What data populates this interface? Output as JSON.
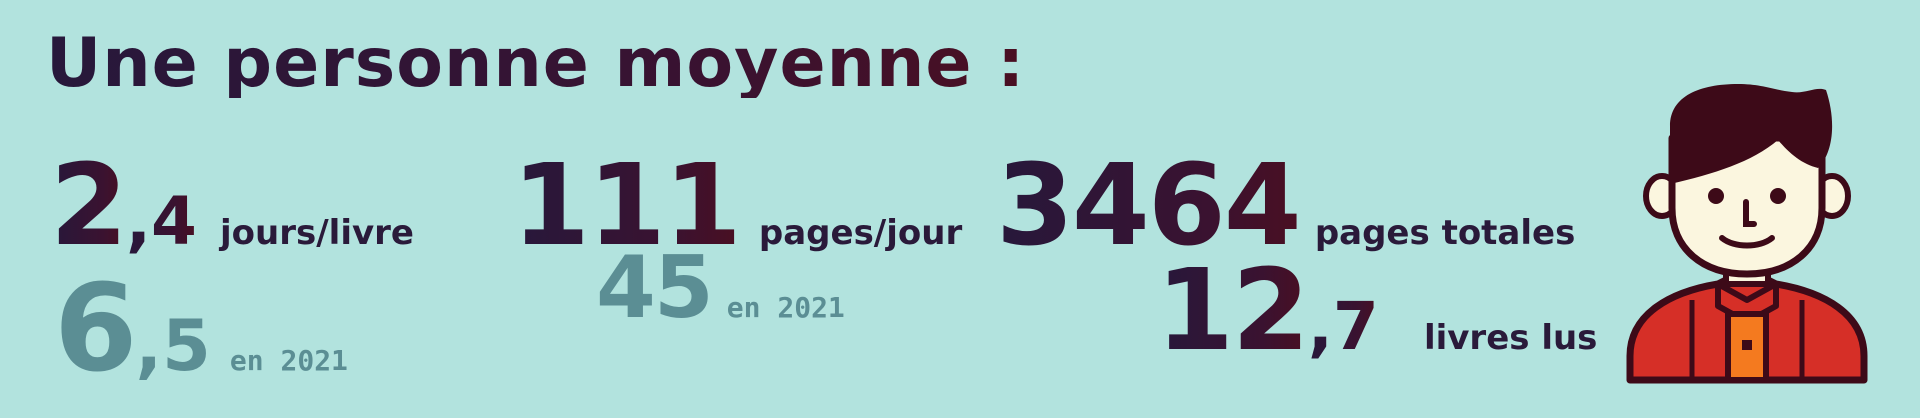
{
  "title": "Une personne moyenne :",
  "stats": {
    "days_per_book": {
      "int": "2",
      "dec": ",4",
      "unit": "jours/livre"
    },
    "days_per_book_2021": {
      "int": "6",
      "dec": ",5",
      "label": "en 2021"
    },
    "pages_per_day": {
      "value": "111",
      "unit": "pages/jour"
    },
    "pages_per_day_2021": {
      "value": "45",
      "label": "en 2021"
    },
    "total_pages": {
      "value": "3464",
      "unit": "pages totales"
    },
    "books_read": {
      "int": "12",
      "dec": ",7",
      "unit": "livres lus"
    }
  },
  "colors": {
    "background": "#b2e3de",
    "text_dark": "#2a1a3a",
    "text_muted": "#5b8e94",
    "hair": "#3d0a18",
    "skin": "#fbf6df",
    "shirt": "#d62f27",
    "accent": "#f47a1f"
  },
  "icons": {
    "avatar": "person-avatar-icon"
  }
}
